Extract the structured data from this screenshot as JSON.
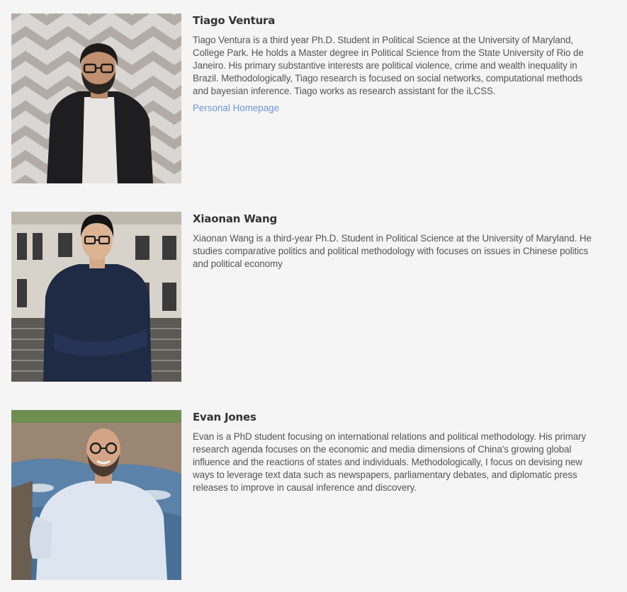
{
  "people": [
    {
      "name": "Tiago Ventura",
      "bio": "Tiago Ventura is a third year Ph.D. Student in Political Science at the University of Maryland, College Park. He holds a Master degree in Political Science from the State University of Rio de Janeiro. His primary substantive interests are political violence, crime and wealth inequality in Brazil. Methodologically, Tiago research is focused on social networks, computational methods and bayesian inference. Tiago works as research assistant for the iLCSS.",
      "link_label": "Personal Homepage"
    },
    {
      "name": "Xiaonan Wang",
      "bio": "Xiaonan Wang is a third-year Ph.D. Student in Political Science at the University of Maryland. He studies comparative politics and political methodology with focuses on issues in Chinese politics and political economy"
    },
    {
      "name": "Evan Jones",
      "bio": "Evan is a PhD student focusing on international relations and political methodology. His primary research agenda focuses on the economic and media dimensions of China's growing global influence and the reactions of states and individuals. Methodologically, I focus on devising new ways to leverage text data such as newspapers, parliamentary debates, and diplomatic press releases to improve in causal inference and discovery."
    }
  ],
  "colors": {
    "background": "#f5f5f5",
    "name_text": "#333333",
    "bio_text": "#555555",
    "link": "#6f96d1"
  }
}
